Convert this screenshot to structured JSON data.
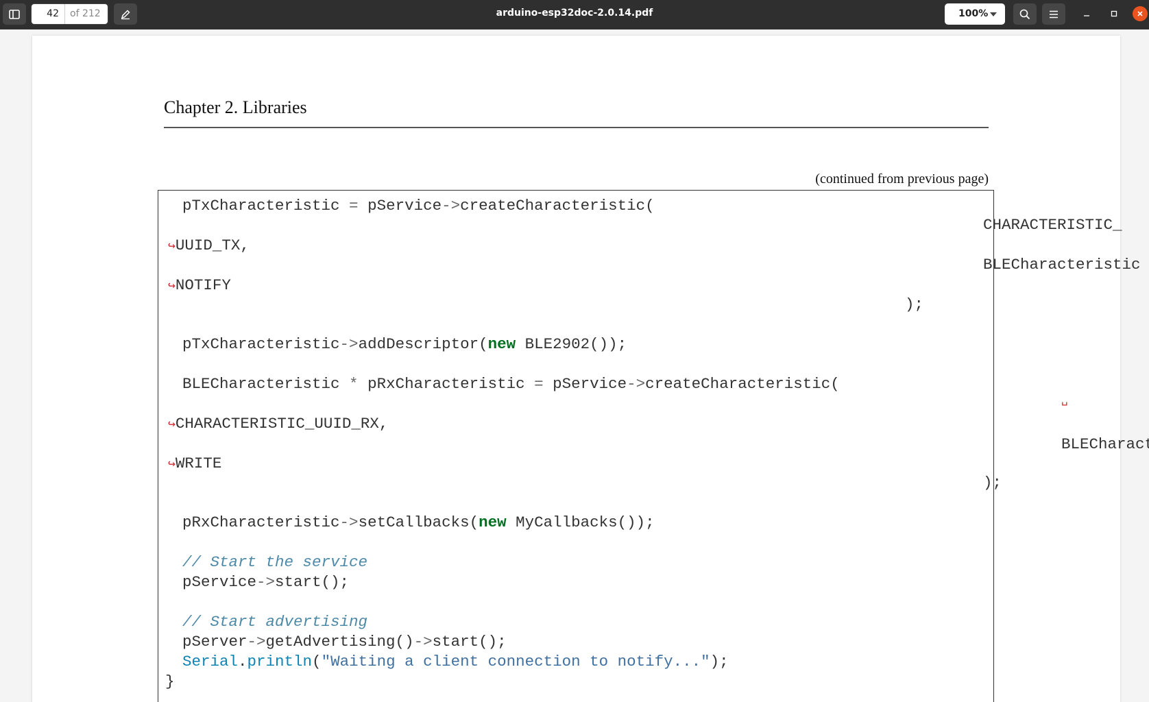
{
  "toolbar": {
    "page_current": "42",
    "page_total": "of 212",
    "document_title": "arduino-esp32doc-2.0.14.pdf",
    "zoom": "100%"
  },
  "page": {
    "chapter": "Chapter 2.  Libraries",
    "continued": "(continued from previous page)",
    "code": {
      "l1": "pTxCharacteristic",
      "l1b": " = ",
      "l1c": "pService",
      "l1d": "->",
      "l1e": "createCharacteristic(",
      "r1": "CHARACTERISTIC_",
      "l2": "UUID_TX,",
      "r2": "BLECharacteristic",
      "l3": "NOTIFY",
      "l4": ");",
      "l5a": "pTxCharacteristic",
      "l5b": "->",
      "l5c": "addDescriptor(",
      "l5d": "new",
      "l5e": " BLE2902());",
      "l6a": "BLECharacteristic ",
      "l6b": "*",
      "l6c": " pRxCharacteristic ",
      "l6d": "=",
      "l6e": " pService",
      "l6f": "->",
      "l6g": "createCharacteristic(",
      "space_mark": "␣",
      "l7": "CHARACTERISTIC_UUID_RX,",
      "r7": "BLECharact",
      "l8": "WRITE",
      "l9": ");",
      "l10a": "pRxCharacteristic",
      "l10b": "->",
      "l10c": "setCallbacks(",
      "l10d": "new",
      "l10e": " MyCallbacks());",
      "c1": "// Start the service",
      "l11a": "pService",
      "l11b": "->",
      "l11c": "start();",
      "c2": "// Start advertising",
      "l12a": "pServer",
      "l12b": "->",
      "l12c": "getAdvertising()",
      "l12d": "->",
      "l12e": "start();",
      "l13a": "Serial",
      "l13b": ".",
      "l13c": "println",
      "l13d": "(",
      "l13e": "\"Waiting a client connection to notify...\"",
      "l13f": ");",
      "l14": "}",
      "wrap_arrow": "↪"
    }
  },
  "colors": {
    "titlebar": "#2f2f2f",
    "close_button": "#e95420",
    "keyword": "#007020",
    "comment": "#4d8aa8",
    "string": "#4070a0",
    "wrap_marker": "#d0282e"
  }
}
